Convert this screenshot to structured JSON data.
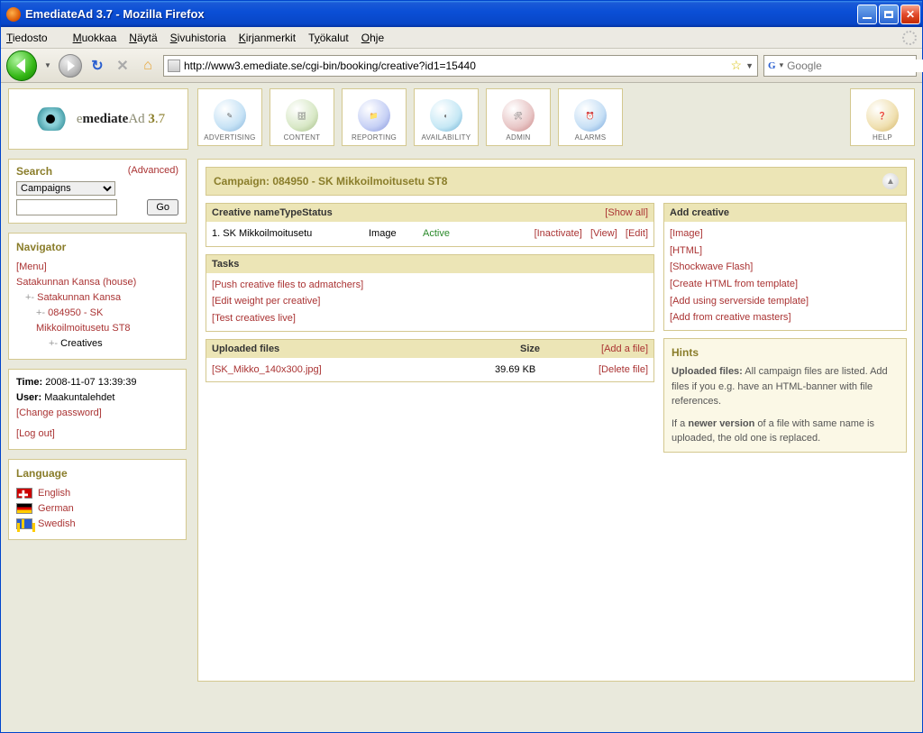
{
  "window": {
    "title": "EmediateAd 3.7 - Mozilla Firefox"
  },
  "menubar": [
    "Tiedosto",
    "Muokkaa",
    "Näytä",
    "Sivuhistoria",
    "Kirjanmerkit",
    "Työkalut",
    "Ohje"
  ],
  "url": "http://www3.emediate.se/cgi-bin/booking/creative?id1=15440",
  "search_placeholder": "Google",
  "appnav": [
    "ADVERTISING",
    "CONTENT",
    "REPORTING",
    "AVAILABILITY",
    "ADMIN",
    "ALARMS",
    "HELP"
  ],
  "logo_text": "emediateAd 3.7",
  "search_panel": {
    "title": "Search",
    "advanced": "(Advanced)",
    "select": "Campaigns",
    "go": "Go"
  },
  "navigator": {
    "title": "Navigator",
    "menu": "Menu",
    "root": "Satakunnan Kansa (house)",
    "l1": "Satakunnan Kansa",
    "l2": "084950 - SK Mikkoilmoitusetu ST8",
    "l3": "Creatives"
  },
  "session": {
    "time_label": "Time:",
    "time": "2008-11-07 13:39:39",
    "user_label": "User:",
    "user": "Maakuntalehdet",
    "change_pw": "Change password",
    "logout": "Log out"
  },
  "language": {
    "title": "Language",
    "items": [
      "English",
      "German",
      "Swedish"
    ]
  },
  "campaign_title": "Campaign: 084950 - SK Mikkoilmoitusetu ST8",
  "creatives": {
    "hdr": {
      "name": "Creative name",
      "type": "Type",
      "status": "Status",
      "showall": "Show all"
    },
    "rows": [
      {
        "name": "1. SK Mikkoilmoitusetu",
        "type": "Image",
        "status": "Active",
        "inactivate": "Inactivate",
        "view": "View",
        "edit": "Edit"
      }
    ]
  },
  "tasks": {
    "title": "Tasks",
    "items": [
      "Push creative files to admatchers",
      "Edit weight per creative",
      "Test creatives live"
    ]
  },
  "uploaded": {
    "title": "Uploaded files",
    "size": "Size",
    "add": "Add a file",
    "rows": [
      {
        "name": "SK_Mikko_140x300.jpg",
        "size": "39.69 KB",
        "del": "Delete file"
      }
    ]
  },
  "addcreative": {
    "title": "Add creative",
    "items": [
      "Image",
      "HTML",
      "Shockwave Flash",
      "Create HTML from template",
      "Add using serverside template",
      "Add from creative masters"
    ]
  },
  "hints": {
    "title": "Hints",
    "p1a": "Uploaded files:",
    "p1b": " All campaign files are listed. Add files if you e.g. have an HTML-banner with file references.",
    "p2a": "If a ",
    "p2b": "newer version",
    "p2c": " of a file with same name is uploaded, the old one is replaced."
  }
}
